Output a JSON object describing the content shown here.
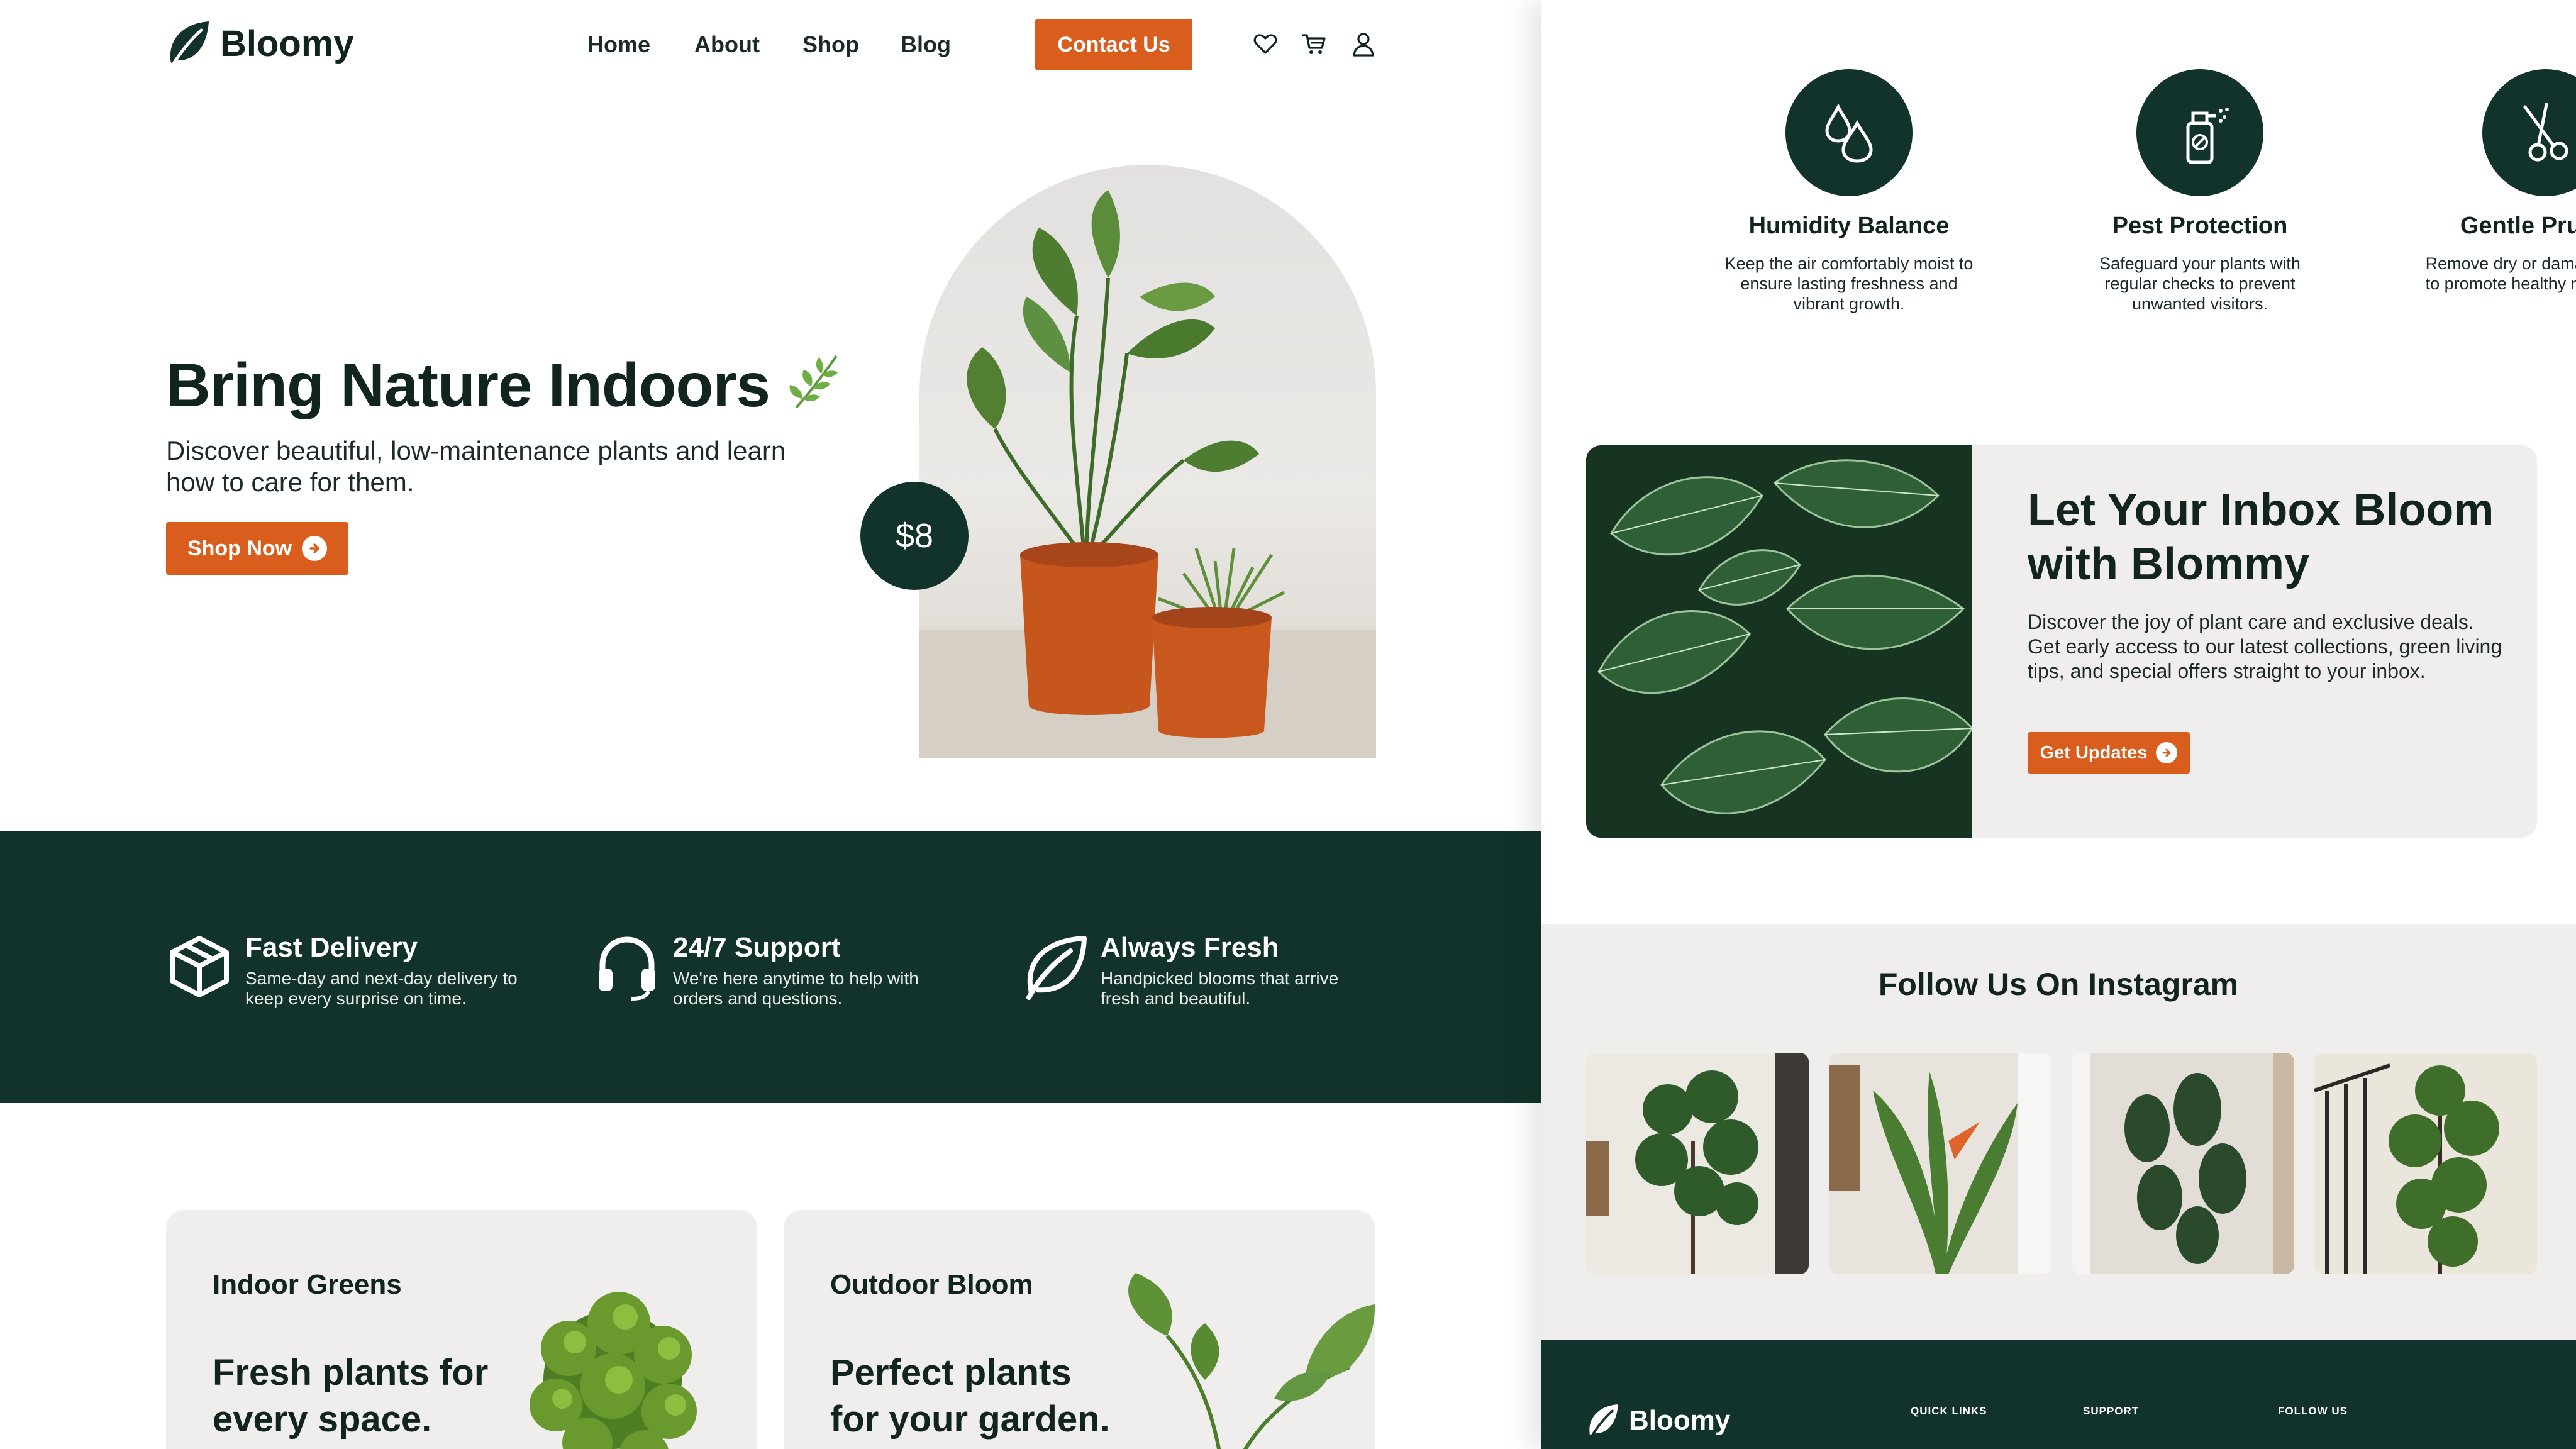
{
  "brand": {
    "name": "Bloomy",
    "logo_icon": "leaf-icon"
  },
  "nav": {
    "home": "Home",
    "about": "About",
    "shop": "Shop",
    "blog": "Blog",
    "contact": "Contact Us",
    "icons": [
      "heart-icon",
      "cart-icon",
      "user-icon"
    ]
  },
  "hero": {
    "title": "Bring Nature Indoors",
    "subtitle": "Discover beautiful, low-maintenance plants and learn how to care for them.",
    "cta": "Shop Now",
    "price": "$8"
  },
  "features": [
    {
      "icon": "box-icon",
      "title": "Fast Delivery",
      "desc": "Same-day and next-day delivery to keep every surprise on time."
    },
    {
      "icon": "headset-icon",
      "title": "24/7 Support",
      "desc": "We're here anytime to help with orders and questions."
    },
    {
      "icon": "leaf-icon",
      "title": "Always Fresh",
      "desc": "Handpicked blooms that arrive fresh and beautiful."
    }
  ],
  "categories": [
    {
      "name": "Indoor Greens",
      "tagline": "Fresh plants for every space."
    },
    {
      "name": "Outdoor Bloom",
      "tagline": "Perfect plants for your garden."
    }
  ],
  "care_tips": [
    {
      "icon": "water-drops-icon",
      "title": "Humidity Balance",
      "desc": "Keep the air comfortably moist to ensure lasting freshness and vibrant growth."
    },
    {
      "icon": "spray-bottle-icon",
      "title": "Pest Protection",
      "desc": "Safeguard your plants with regular checks to prevent unwanted visitors."
    },
    {
      "icon": "scissors-icon",
      "title": "Gentle Pruning",
      "desc": "Remove dry or damaged leaves to promote healthy new blooms."
    }
  ],
  "newsletter": {
    "title": "Let Your Inbox Bloom with Blommy",
    "desc": "Discover the joy of plant care and exclusive deals. Get early access to our latest collections, green living tips, and special offers straight to your inbox.",
    "cta": "Get Updates"
  },
  "instagram": {
    "title": "Follow Us On Instagram"
  },
  "footer": {
    "brand": "Bloomy",
    "quick_links": "QUICK LINKS",
    "support": "SUPPORT",
    "follow_us": "FOLLOW US"
  },
  "colors": {
    "accent": "#d95d1c",
    "dark_green": "#11332b",
    "card_bg": "#efeeed"
  }
}
